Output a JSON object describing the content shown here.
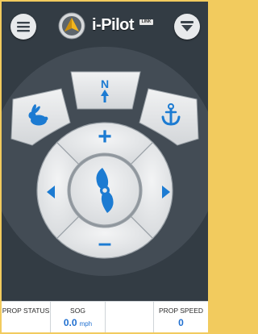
{
  "header": {
    "logo_text": "i-Pilot",
    "logo_badge": "LINK",
    "menu_icon": "hamburger-menu-icon",
    "dropdown_icon": "down-arrow-icon"
  },
  "controls": {
    "north_label": "N",
    "up_label": "+",
    "down_label": "–",
    "colors": {
      "accent_blue": "#1c7bd2",
      "button_face": "#e6e8ea",
      "ring_dark": "#4a545d",
      "background": "#333c44"
    },
    "icons": [
      "rabbit-icon",
      "anchor-icon",
      "north-arrow-icon",
      "left-arrow-icon",
      "right-arrow-icon",
      "propeller-icon"
    ]
  },
  "footer": {
    "prop_status": {
      "label": "PROP STATUS",
      "value": ""
    },
    "sog": {
      "label": "SOG",
      "value": "0.0",
      "unit": "mph"
    },
    "blank": {
      "label": "",
      "value": ""
    },
    "prop_speed": {
      "label": "PROP SPEED",
      "value": "0"
    }
  }
}
